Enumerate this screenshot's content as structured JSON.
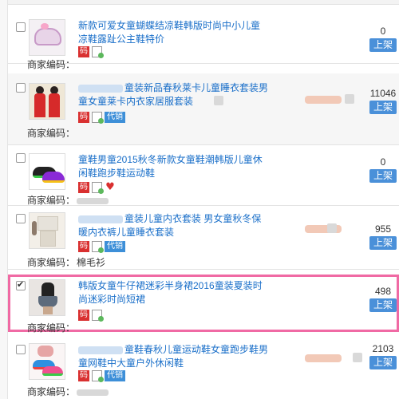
{
  "merchant_code_label": "商家编码：",
  "shelf_button_label": "上架",
  "tag_labels": {
    "ma": "码",
    "daixiao": "代销"
  },
  "icons": {
    "checkbox": "checkbox-icon",
    "document": "document-icon",
    "heart": "heart-icon",
    "edit": "pencil-icon"
  },
  "colors": {
    "link": "#1a6fc9",
    "shelf_button": "#4a90d9",
    "tag_red": "#d93030",
    "tag_blue": "#3d8fd8",
    "selection_outline": "#f06aa4"
  },
  "products": [
    {
      "title": "新款可爱女童蝴蝶结凉鞋韩版时尚中小儿童凉鞋露趾公主鞋特价",
      "stock": "0",
      "merchant_code": "",
      "checked": false,
      "tags": [
        "ma",
        "doc"
      ]
    },
    {
      "title": "童装新品春秋莱卡儿童睡衣套装男童女童莱卡内衣家居服套装",
      "stock": "11046",
      "merchant_code": "",
      "checked": false,
      "tags": [
        "ma",
        "doc",
        "daixiao"
      ]
    },
    {
      "title": "童鞋男童2015秋冬新款女童鞋潮韩版儿童休闲鞋跑步鞋运动鞋",
      "stock": "0",
      "merchant_code": "",
      "checked": false,
      "tags": [
        "ma",
        "doc",
        "heart"
      ]
    },
    {
      "title": "童装儿童内衣套装 男女童秋冬保暖内衣裤儿童睡衣套装",
      "stock": "955",
      "merchant_code": "棉毛衫",
      "checked": false,
      "tags": [
        "ma",
        "doc",
        "daixiao"
      ]
    },
    {
      "title": "韩版女童牛仔裙迷彩半身裙2016童装夏装时尚迷彩时尚短裙",
      "stock": "498",
      "merchant_code": "",
      "checked": true,
      "tags": [
        "ma",
        "doc"
      ]
    },
    {
      "title": "童鞋春秋儿童运动鞋女童跑步鞋男童网鞋中大童户外休闲鞋",
      "stock": "2103",
      "merchant_code": "",
      "checked": false,
      "tags": [
        "ma",
        "doc",
        "daixiao"
      ]
    }
  ]
}
